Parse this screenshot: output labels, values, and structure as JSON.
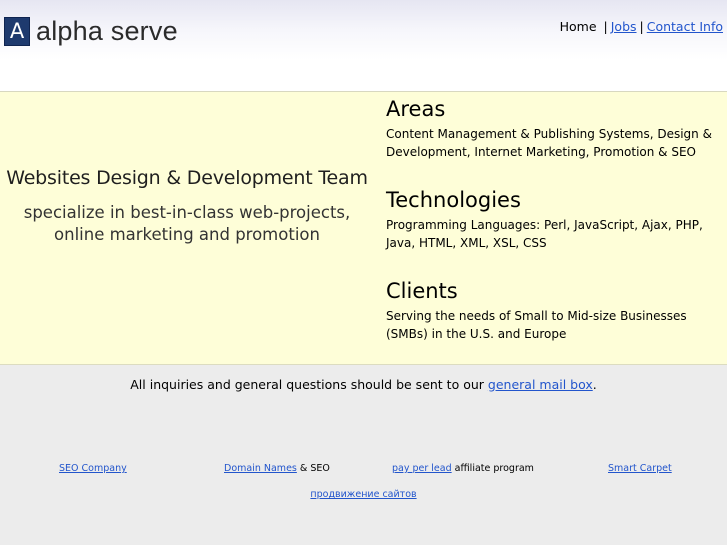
{
  "header": {
    "logo_letter": "A",
    "logo_text": "alpha serve",
    "nav": {
      "home": "Home",
      "separator": "|",
      "jobs": "Jobs",
      "contact": "Contact Info"
    }
  },
  "hero": {
    "title": "Websites Design & Development Team",
    "subtitle_line1": "specialize in best-in-class web-projects,",
    "subtitle_line2": "online marketing and promotion"
  },
  "sections": [
    {
      "heading": "Areas",
      "text": "Content Management & Publishing Systems, Design & Development, Internet Marketing, Promotion & SEO"
    },
    {
      "heading": "Technologies",
      "text": "Programming Languages: Perl, JavaScript, Ajax, PHP, Java, HTML, XML, XSL, CSS"
    },
    {
      "heading": "Clients",
      "text": "Serving the needs of Small to Mid-size Businesses (SMBs) in the U.S. and Europe"
    }
  ],
  "inquiry": {
    "prefix": "All inquiries and general questions should be sent to our",
    "link": "general mail box",
    "suffix": "."
  },
  "footer": {
    "seo_company": "SEO Company",
    "domain_names": "Domain Names",
    "domain_names_suffix": "& SEO",
    "pay_per_lead": "pay per lead",
    "pay_per_lead_suffix": "affiliate program",
    "smart_carpet": "Smart Carpet",
    "russian_link": "продвижение сайтов"
  },
  "colors": {
    "band_background": "#fefed8",
    "page_background": "#ececec",
    "link": "#2255cc",
    "logo_mark": "#1e3a6e"
  }
}
